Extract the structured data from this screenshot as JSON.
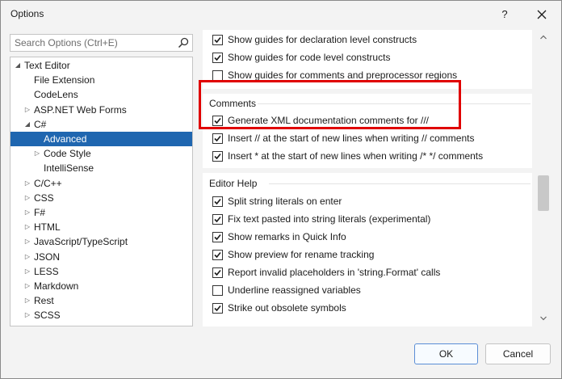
{
  "window": {
    "title": "Options",
    "help_label": "?"
  },
  "search": {
    "placeholder": "Search Options (Ctrl+E)"
  },
  "tree": {
    "items": [
      {
        "label": "Text Editor",
        "depth": 0,
        "expander": "expanded"
      },
      {
        "label": "File Extension",
        "depth": 1,
        "expander": "none"
      },
      {
        "label": "CodeLens",
        "depth": 1,
        "expander": "none"
      },
      {
        "label": "ASP.NET Web Forms",
        "depth": 1,
        "expander": "collapsed"
      },
      {
        "label": "C#",
        "depth": 1,
        "expander": "expanded"
      },
      {
        "label": "Advanced",
        "depth": 2,
        "expander": "none",
        "selected": true
      },
      {
        "label": "Code Style",
        "depth": 2,
        "expander": "collapsed"
      },
      {
        "label": "IntelliSense",
        "depth": 2,
        "expander": "none"
      },
      {
        "label": "C/C++",
        "depth": 1,
        "expander": "collapsed"
      },
      {
        "label": "CSS",
        "depth": 1,
        "expander": "collapsed"
      },
      {
        "label": "F#",
        "depth": 1,
        "expander": "collapsed"
      },
      {
        "label": "HTML",
        "depth": 1,
        "expander": "collapsed"
      },
      {
        "label": "JavaScript/TypeScript",
        "depth": 1,
        "expander": "collapsed"
      },
      {
        "label": "JSON",
        "depth": 1,
        "expander": "collapsed"
      },
      {
        "label": "LESS",
        "depth": 1,
        "expander": "collapsed"
      },
      {
        "label": "Markdown",
        "depth": 1,
        "expander": "collapsed"
      },
      {
        "label": "Rest",
        "depth": 1,
        "expander": "collapsed"
      },
      {
        "label": "SCSS",
        "depth": 1,
        "expander": "collapsed"
      }
    ]
  },
  "sections": {
    "guides": {
      "options": [
        {
          "label": "Show guides for declaration level constructs",
          "checked": true
        },
        {
          "label": "Show guides for code level constructs",
          "checked": true
        },
        {
          "label": "Show guides for comments and preprocessor regions",
          "checked": false
        }
      ]
    },
    "comments": {
      "title": "Comments",
      "options": [
        {
          "label": "Generate XML documentation comments for ///",
          "checked": true
        },
        {
          "label": "Insert // at the start of new lines when writing // comments",
          "checked": true
        },
        {
          "label": "Insert * at the start of new lines when writing /* */ comments",
          "checked": true
        }
      ]
    },
    "editor_help": {
      "title": "Editor Help",
      "options": [
        {
          "label": "Split string literals on enter",
          "checked": true
        },
        {
          "label": "Fix text pasted into string literals (experimental)",
          "checked": true
        },
        {
          "label": "Show remarks in Quick Info",
          "checked": true
        },
        {
          "label": "Show preview for rename tracking",
          "checked": true
        },
        {
          "label": "Report invalid placeholders in 'string.Format' calls",
          "checked": true
        },
        {
          "label": "Underline reassigned variables",
          "checked": false
        },
        {
          "label": "Strike out obsolete symbols",
          "checked": true
        }
      ]
    }
  },
  "buttons": {
    "ok": "OK",
    "cancel": "Cancel"
  },
  "colors": {
    "selection": "#1f66b0",
    "highlight_box": "#e00000",
    "ok_border": "#5b8ed6"
  }
}
